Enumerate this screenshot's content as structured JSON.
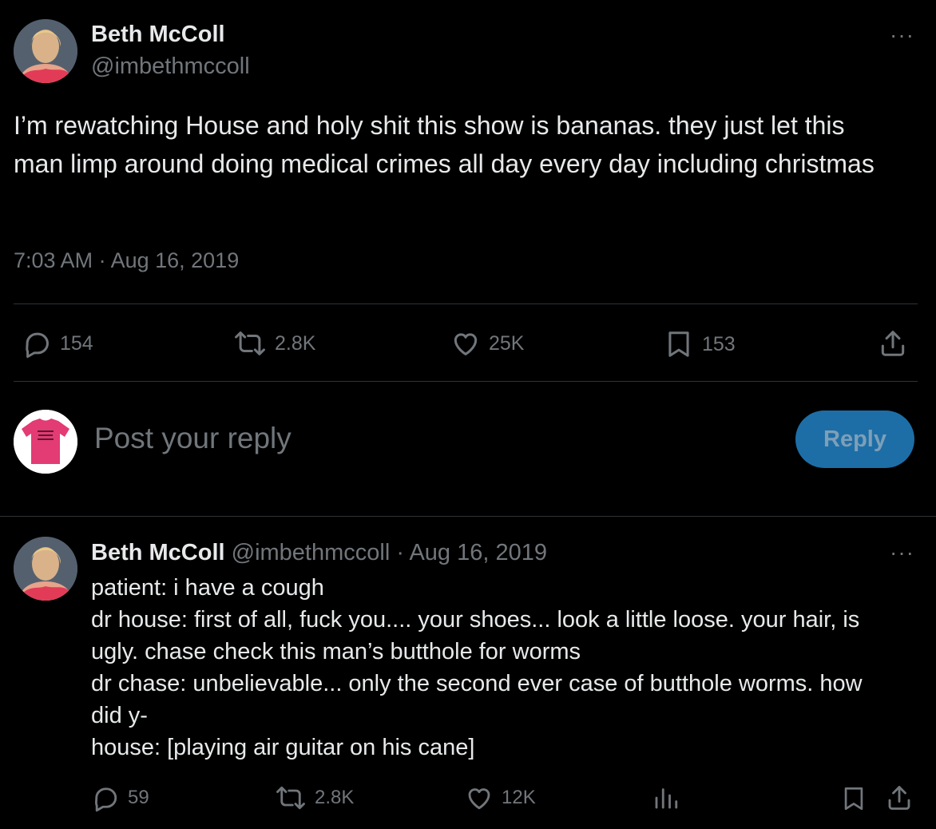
{
  "main_tweet": {
    "author_name": "Beth McColl",
    "author_handle": "@imbethmccoll",
    "more_label": "···",
    "text": "I’m rewatching House and holy shit this show is bananas. they just let this man limp around doing medical crimes all day every day including christmas",
    "timestamp": "7:03 AM · Aug 16, 2019",
    "stats": {
      "replies": "154",
      "reposts": "2.8K",
      "likes": "25K",
      "bookmarks": "153"
    }
  },
  "composer": {
    "placeholder": "Post your reply",
    "button_label": "Reply"
  },
  "reply_tweet": {
    "author_name": "Beth McColl",
    "author_handle": "@imbethmccoll",
    "date": "· Aug 16, 2019",
    "more_label": "···",
    "lines": [
      "patient: i have a cough",
      "dr house: first of all, fuck you.... your shoes... look a little loose. your hair, is",
      "ugly. chase check this man’s butthole for worms",
      "dr chase: unbelievable... only the second ever case of butthole worms. how",
      "did y-",
      "house: [playing air guitar on his cane]"
    ],
    "stats": {
      "replies": "59",
      "reposts": "2.8K",
      "likes": "12K"
    }
  },
  "colors": {
    "background": "#000000",
    "text_primary": "#e7e9ea",
    "text_secondary": "#71767b",
    "divider": "#2f3336",
    "reply_button": "#1d6ea7"
  },
  "icons": [
    "reply-icon",
    "repost-icon",
    "like-icon",
    "bookmark-icon",
    "share-icon",
    "views-icon",
    "more-icon"
  ]
}
